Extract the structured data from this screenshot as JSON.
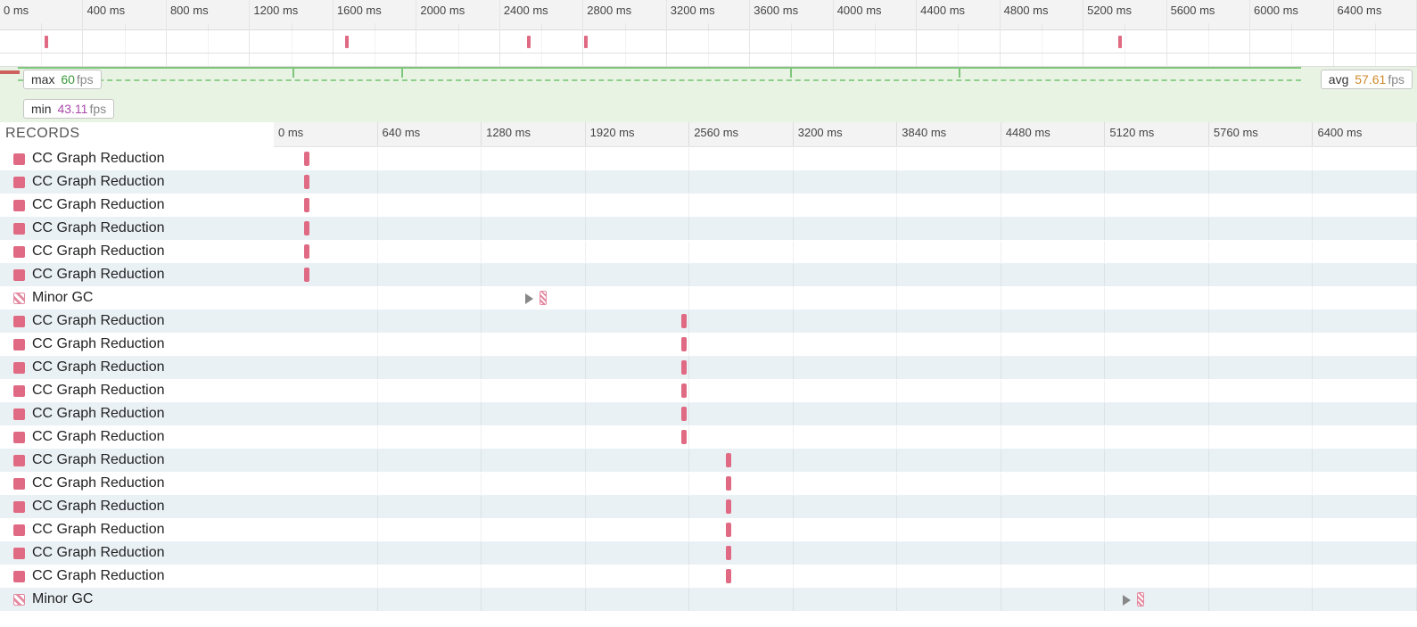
{
  "overview": {
    "range_ms": 6400,
    "ticks": [
      "0 ms",
      "400 ms",
      "800 ms",
      "1200 ms",
      "1600 ms",
      "2000 ms",
      "2400 ms",
      "2800 ms",
      "3200 ms",
      "3600 ms",
      "4000 ms",
      "4400 ms",
      "4800 ms",
      "5200 ms",
      "5600 ms",
      "6000 ms",
      "6400 ms"
    ],
    "markers_ms": [
      200,
      1560,
      2380,
      2640,
      5050
    ]
  },
  "fps": {
    "max_label": "max",
    "max_value": "60",
    "max_unit": "fps",
    "min_label": "min",
    "min_value": "43.11",
    "min_unit": "fps",
    "avg_label": "avg",
    "avg_value": "57.61",
    "avg_unit": "fps",
    "notches_ms": [
      1460,
      2000,
      3940,
      4780
    ]
  },
  "records": {
    "title": "RECORDS",
    "range_ms": 6400,
    "header_ticks": [
      "0 ms",
      "640 ms",
      "1280 ms",
      "1920 ms",
      "2560 ms",
      "3200 ms",
      "3840 ms",
      "4480 ms",
      "5120 ms",
      "5760 ms",
      "6400 ms"
    ],
    "rows": [
      {
        "name": "CC Graph Reduction",
        "type": "cc",
        "marker_start_ms": 170,
        "marker_dur_ms": 30,
        "has_play": false
      },
      {
        "name": "CC Graph Reduction",
        "type": "cc",
        "marker_start_ms": 170,
        "marker_dur_ms": 30,
        "has_play": false
      },
      {
        "name": "CC Graph Reduction",
        "type": "cc",
        "marker_start_ms": 170,
        "marker_dur_ms": 30,
        "has_play": false
      },
      {
        "name": "CC Graph Reduction",
        "type": "cc",
        "marker_start_ms": 170,
        "marker_dur_ms": 30,
        "has_play": false
      },
      {
        "name": "CC Graph Reduction",
        "type": "cc",
        "marker_start_ms": 170,
        "marker_dur_ms": 30,
        "has_play": false
      },
      {
        "name": "CC Graph Reduction",
        "type": "cc",
        "marker_start_ms": 170,
        "marker_dur_ms": 30,
        "has_play": false
      },
      {
        "name": "Minor GC",
        "type": "gc",
        "marker_start_ms": 1490,
        "marker_dur_ms": 40,
        "has_play": true
      },
      {
        "name": "CC Graph Reduction",
        "type": "cc",
        "marker_start_ms": 2280,
        "marker_dur_ms": 30,
        "has_play": false
      },
      {
        "name": "CC Graph Reduction",
        "type": "cc",
        "marker_start_ms": 2280,
        "marker_dur_ms": 30,
        "has_play": false
      },
      {
        "name": "CC Graph Reduction",
        "type": "cc",
        "marker_start_ms": 2280,
        "marker_dur_ms": 30,
        "has_play": false
      },
      {
        "name": "CC Graph Reduction",
        "type": "cc",
        "marker_start_ms": 2280,
        "marker_dur_ms": 30,
        "has_play": false
      },
      {
        "name": "CC Graph Reduction",
        "type": "cc",
        "marker_start_ms": 2280,
        "marker_dur_ms": 30,
        "has_play": false
      },
      {
        "name": "CC Graph Reduction",
        "type": "cc",
        "marker_start_ms": 2280,
        "marker_dur_ms": 30,
        "has_play": false
      },
      {
        "name": "CC Graph Reduction",
        "type": "cc",
        "marker_start_ms": 2530,
        "marker_dur_ms": 30,
        "has_play": false
      },
      {
        "name": "CC Graph Reduction",
        "type": "cc",
        "marker_start_ms": 2530,
        "marker_dur_ms": 30,
        "has_play": false
      },
      {
        "name": "CC Graph Reduction",
        "type": "cc",
        "marker_start_ms": 2530,
        "marker_dur_ms": 30,
        "has_play": false
      },
      {
        "name": "CC Graph Reduction",
        "type": "cc",
        "marker_start_ms": 2530,
        "marker_dur_ms": 30,
        "has_play": false
      },
      {
        "name": "CC Graph Reduction",
        "type": "cc",
        "marker_start_ms": 2530,
        "marker_dur_ms": 30,
        "has_play": false
      },
      {
        "name": "CC Graph Reduction",
        "type": "cc",
        "marker_start_ms": 2530,
        "marker_dur_ms": 30,
        "has_play": false
      },
      {
        "name": "Minor GC",
        "type": "gc",
        "marker_start_ms": 4830,
        "marker_dur_ms": 40,
        "has_play": true
      }
    ]
  }
}
